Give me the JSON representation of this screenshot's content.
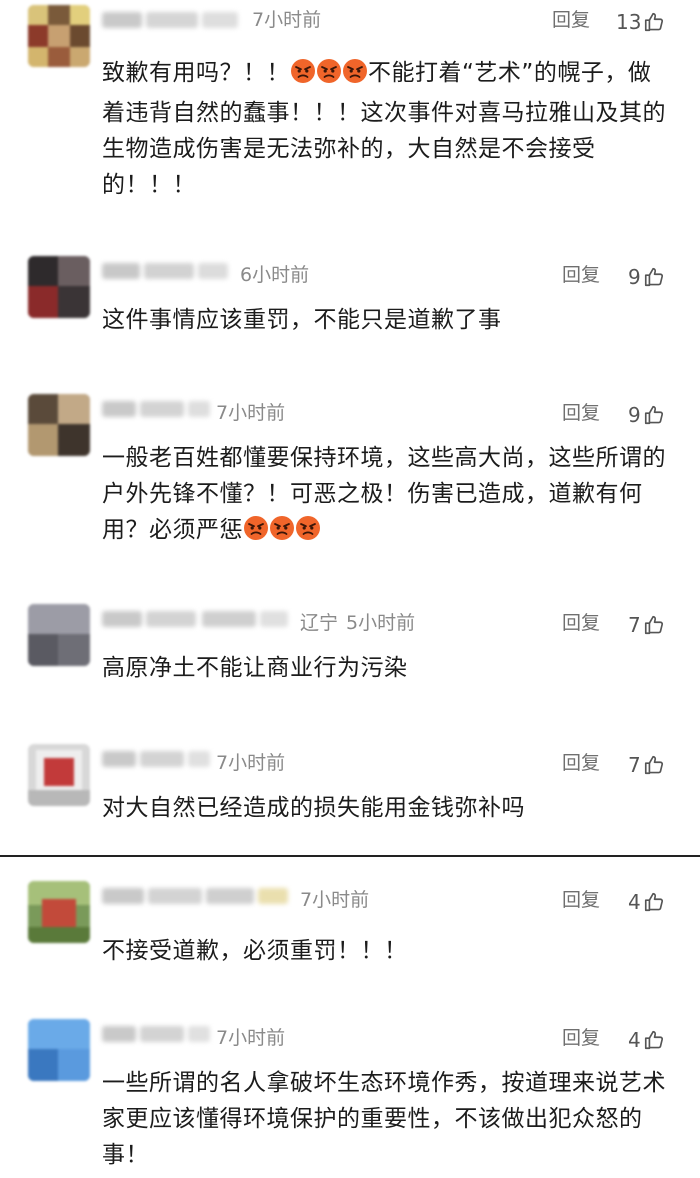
{
  "reply_label": "回复",
  "comments": [
    {
      "time": "7小时前",
      "likes": "13",
      "text_parts": [
        "致歉有用吗？！！",
        "不能打着“艺术”的幌子，做着违背自然的蠢事！！！这次事件对喜马拉雅山及其的生物造成伤害是无法弥补的，大自然是不会接受的！！！"
      ],
      "emojis": [
        "angry-face-icon",
        "angry-face-icon",
        "angry-face-icon"
      ]
    },
    {
      "time": "6小时前",
      "likes": "9",
      "text": "这件事情应该重罚，不能只是道歉了事"
    },
    {
      "time": "7小时前",
      "likes": "9",
      "text": "一般老百姓都懂要保持环境，这些高大尚，这些所谓的户外先锋不懂？！可恶之极！伤害已造成，道歉有何用？必须严惩",
      "emojis": [
        "angry-face-icon",
        "angry-face-icon",
        "angry-face-icon"
      ]
    },
    {
      "location": "辽宁",
      "time": "5小时前",
      "likes": "7",
      "text": "高原净土不能让商业行为污染"
    },
    {
      "time": "7小时前",
      "likes": "7",
      "text": "对大自然已经造成的损失能用金钱弥补吗"
    },
    {
      "time": "7小时前",
      "likes": "4",
      "text": "不接受道歉，必须重罚！！！"
    },
    {
      "time": "7小时前",
      "likes": "4",
      "text": "一些所谓的名人拿破坏生态环境作秀，按道理来说艺术家更应该懂得环境保护的重要性，不该做出犯众怒的事！"
    }
  ],
  "icons": {
    "like": "thumbs-up-outline-icon",
    "emoji": "angry-face-icon"
  },
  "colors": {
    "emoji_face": "#f0652a",
    "emoji_dark": "#3a1608",
    "meta_text": "#8a8a8a",
    "body_text": "#1c1c1c",
    "divider": "#222222"
  }
}
